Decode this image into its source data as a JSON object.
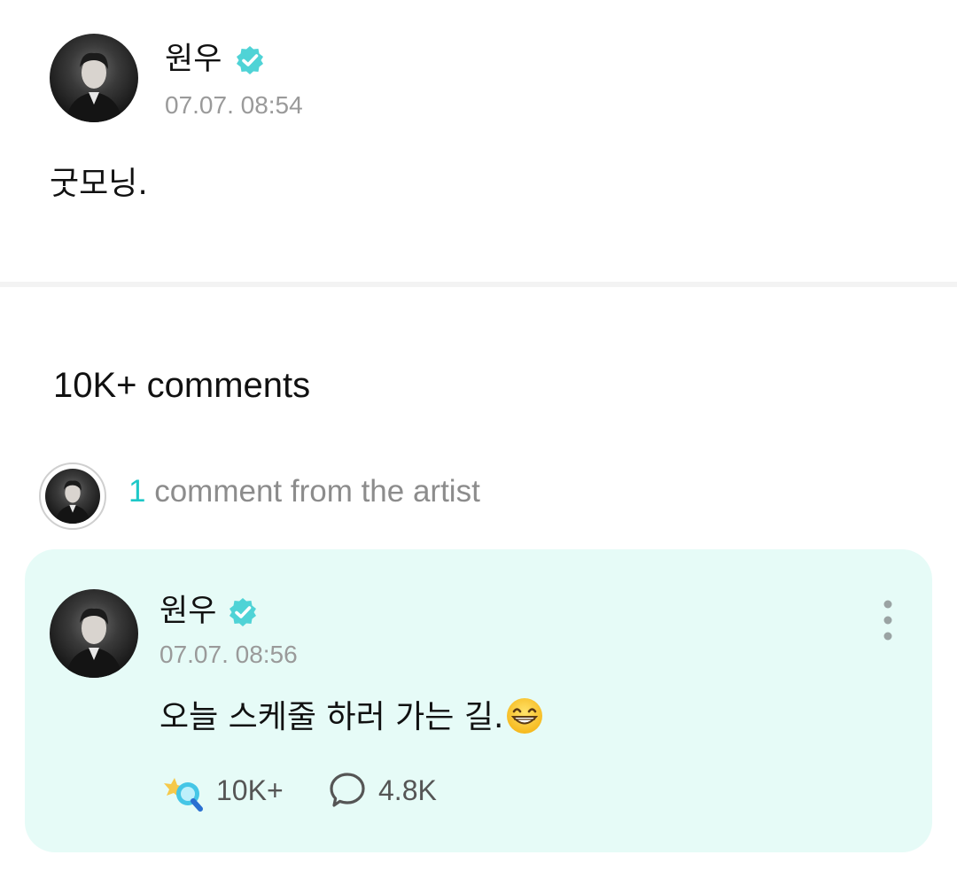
{
  "post": {
    "author": "원우",
    "timestamp": "07.07. 08:54",
    "body": "굿모닝."
  },
  "comments_section": {
    "count_label": "10K+ comments",
    "artist_count": "1",
    "artist_label": "comment from the artist"
  },
  "artist_comment": {
    "author": "원우",
    "timestamp": "07.07. 08:56",
    "text": "오늘 스케줄 하러 가는 길.",
    "likes": "10K+",
    "replies": "4.8K"
  },
  "icons": {
    "verified": "verified-badge-icon",
    "more": "more-vertical-icon",
    "like": "lightstick-like-icon",
    "reply": "speech-bubble-icon",
    "emoji": "grinning-face-emoji"
  },
  "colors": {
    "accent": "#1ec8c8",
    "verified": "#4fd3d6",
    "card_bg": "#e6fbf7",
    "muted_text": "#9a9a9a"
  }
}
